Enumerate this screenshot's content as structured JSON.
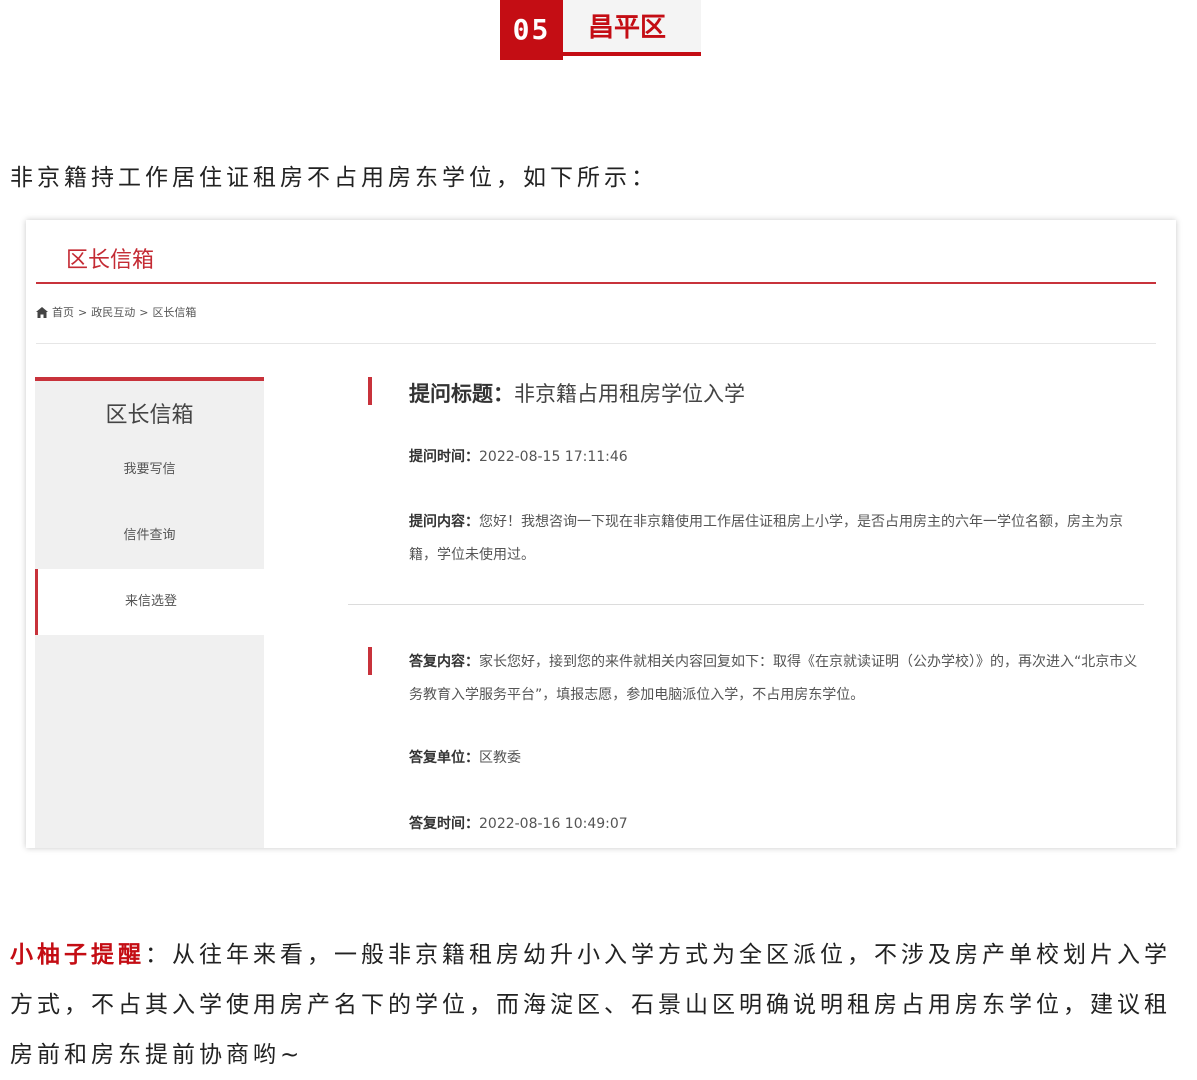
{
  "badge": {
    "number": "05",
    "district": "昌平区"
  },
  "intro": "非京籍持工作居住证租房不占用房东学位，如下所示：",
  "card": {
    "title": "区长信箱",
    "breadcrumb": [
      "首页",
      "政民互动",
      "区长信箱"
    ],
    "breadcrumb_sep": ">",
    "sidebar": {
      "title": "区长信箱",
      "items": [
        "我要写信",
        "信件查询",
        "来信选登"
      ]
    },
    "question": {
      "title_label": "提问标题：",
      "title": "非京籍占用租房学位入学",
      "time_label": "提问时间：",
      "time": "2022-08-15 17:11:46",
      "content_label": "提问内容：",
      "content": "您好！我想咨询一下现在非京籍使用工作居住证租房上小学，是否占用房主的六年一学位名额，房主为京籍，学位未使用过。"
    },
    "answer": {
      "content_label": "答复内容：",
      "content": "家长您好，接到您的来件就相关内容回复如下：取得《在京就读证明（公办学校）》的，再次进入“北京市义务教育入学服务平台”，填报志愿，参加电脑派位入学，不占用房东学位。",
      "unit_label": "答复单位：",
      "unit": "区教委",
      "time_label": "答复时间：",
      "time": "2022-08-16 10:49:07"
    }
  },
  "tip": {
    "label": "小柚子提醒",
    "text": "：从往年来看，一般非京籍租房幼升小入学方式为全区派位，不涉及房产单校划片入学方式，不占其入学使用房产名下的学位，而海淀区、石景山区明确说明租房占用房东学位，建议租房前和房东提前协商哟~"
  }
}
